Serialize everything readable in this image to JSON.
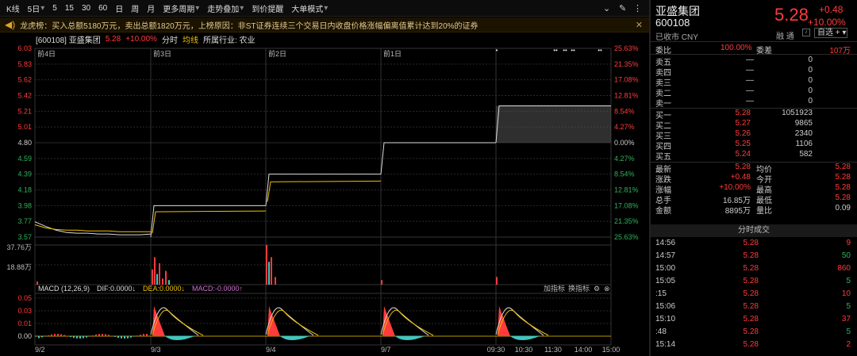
{
  "toolbar": {
    "items": [
      "K线",
      "5日",
      "5",
      "15",
      "30",
      "60",
      "日",
      "周",
      "月",
      "更多周期",
      "走势叠加",
      "到价提醒",
      "大单模式"
    ]
  },
  "news": {
    "text": "龙虎榜：买入总额5180万元，卖出总额1820万元，上榜原因：非ST证券连续三个交易日内收盘价格涨幅偏离值累计达到20%的证券"
  },
  "info": {
    "code": "[600108] 亚盛集团",
    "price": "5.28",
    "pct": "+10.00%",
    "tab1": "分时",
    "tab2": "均线",
    "industry": "所属行业: 农业"
  },
  "chart_data": {
    "type": "line",
    "title": "",
    "price_axis": [
      "6.03",
      "5.83",
      "5.62",
      "5.42",
      "5.21",
      "5.01",
      "4.80",
      "4.59",
      "4.39",
      "4.18",
      "3.98",
      "3.77",
      "3.57"
    ],
    "pct_axis": [
      "25.63%",
      "21.35%",
      "17.08%",
      "12.81%",
      "8.54%",
      "4.27%",
      "0.00%",
      "4.27%",
      "8.54%",
      "12.81%",
      "17.08%",
      "21.35%",
      "25.63%"
    ],
    "day_labels": [
      "前4日",
      "前3日",
      "前2日",
      "前1日"
    ],
    "x_labels": [
      "9/2",
      "9/3",
      "9/4",
      "9/7",
      "09:30",
      "10:30",
      "11:30",
      "14:00",
      "15:00"
    ],
    "prev_close": 4.8,
    "day_close": [
      3.57,
      3.98,
      4.39,
      4.8,
      5.28
    ],
    "volume_axis": [
      "37.76万",
      "18.88万"
    ],
    "macd": {
      "label": "MACD (12,26,9)",
      "dif": "DIF:0.0000",
      "dea": "DEA:0.0000",
      "macd": "MACD:-0.0000",
      "axis": [
        "0.05",
        "0.03",
        "0.01",
        "0.00"
      ],
      "btns": [
        "加指标",
        "换指标"
      ]
    },
    "colors": {
      "up": "#ff3b3b",
      "down": "#2fb35a",
      "price": "#dddddd",
      "avg": "#f0c000"
    }
  },
  "right": {
    "name": "亚盛集团",
    "code": "600108",
    "status": "已收市 CNY",
    "price": "5.28",
    "change": "+0.48",
    "pct": "+10.00%",
    "rz": "融 通",
    "zx": "自选 +",
    "wb": {
      "l1": "委比",
      "v1": "100.00%",
      "l2": "委差",
      "v2": "107万"
    },
    "sells": [
      [
        "卖五",
        "—",
        "0"
      ],
      [
        "卖四",
        "—",
        "0"
      ],
      [
        "卖三",
        "—",
        "0"
      ],
      [
        "卖二",
        "—",
        "0"
      ],
      [
        "卖一",
        "—",
        "0"
      ]
    ],
    "buys": [
      [
        "买一",
        "5.28",
        "1051923"
      ],
      [
        "买二",
        "5.27",
        "9865"
      ],
      [
        "买三",
        "5.26",
        "2340"
      ],
      [
        "买四",
        "5.25",
        "1106"
      ],
      [
        "买五",
        "5.24",
        "582"
      ]
    ],
    "stats": [
      [
        "最新",
        "5.28",
        "均价",
        "5.28"
      ],
      [
        "涨跌",
        "+0.48",
        "今开",
        "5.28"
      ],
      [
        "涨幅",
        "+10.00%",
        "最高",
        "5.28"
      ],
      [
        "总手",
        "16.85万",
        "最低",
        "5.28"
      ],
      [
        "金额",
        "8895万",
        "量比",
        "0.09"
      ]
    ],
    "trades_title": "分时成交",
    "trades": [
      [
        "14:56",
        "5.28",
        "9"
      ],
      [
        "14:57",
        "5.28",
        "50"
      ],
      [
        "15:00",
        "5.28",
        "860"
      ],
      [
        "15:05",
        "5.28",
        "5"
      ],
      [
        ":15",
        "5.28",
        "10"
      ],
      [
        "15:06",
        "5.28",
        "5"
      ],
      [
        "15:10",
        "5.28",
        "37"
      ],
      [
        ":48",
        "5.28",
        "5"
      ],
      [
        "15:14",
        "5.28",
        "2"
      ]
    ]
  }
}
